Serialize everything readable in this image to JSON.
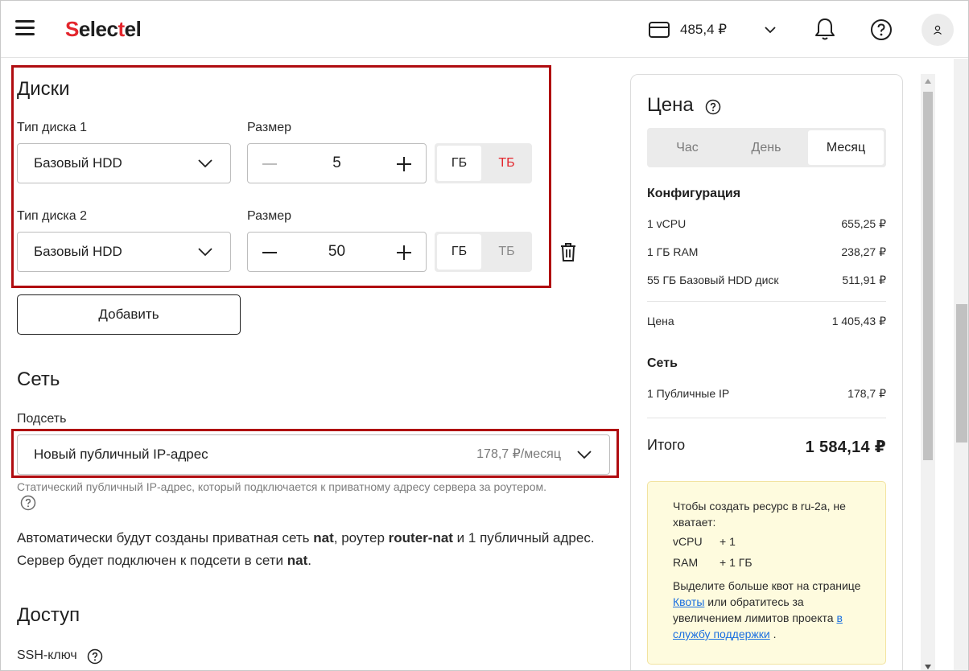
{
  "header": {
    "logo_prefix": "S",
    "logo_mid": "elec",
    "logo_red2": "t",
    "logo_suffix": "el",
    "balance": "485,4 ₽"
  },
  "disks": {
    "title": "Диски",
    "items": [
      {
        "type_label": "Тип диска 1",
        "size_label": "Размер",
        "type_value": "Базовый HDD",
        "size": "5",
        "unit_gb": "ГБ",
        "unit_tb": "ТБ"
      },
      {
        "type_label": "Тип диска 2",
        "size_label": "Размер",
        "type_value": "Базовый HDD",
        "size": "50",
        "unit_gb": "ГБ",
        "unit_tb": "ТБ"
      }
    ],
    "add_label": "Добавить"
  },
  "network": {
    "title": "Сеть",
    "subnet_label": "Подсеть",
    "subnet_value": "Новый публичный IP-адрес",
    "subnet_price": "178,7 ₽/месяц",
    "hint": "Статический публичный IP-адрес, который подключается к приватному адресу сервера за роутером.",
    "para_1": "Автоматически будут созданы приватная сеть ",
    "para_nat": "nat",
    "para_2": ", роутер ",
    "para_router": "router-nat",
    "para_3": " и 1 публичный адрес. Сервер будет подключен к подсети в сети ",
    "para_nat2": "nat",
    "para_4": "."
  },
  "access": {
    "title": "Доступ",
    "ssh_label": "SSH-ключ"
  },
  "price_panel": {
    "title": "Цена",
    "tabs": [
      "Час",
      "День",
      "Месяц"
    ],
    "active_tab": "Месяц",
    "config_title": "Конфигурация",
    "config_rows": [
      {
        "name": "1 vCPU",
        "price": "655,25 ₽"
      },
      {
        "name": "1 ГБ RAM",
        "price": "238,27 ₽"
      },
      {
        "name": "55 ГБ Базовый HDD диск",
        "price": "511,91 ₽"
      }
    ],
    "price_label": "Цена",
    "price_value": "1 405,43 ₽",
    "net_title": "Сеть",
    "net_row": {
      "name": "1 Публичные IP",
      "price": "178,7 ₽"
    },
    "total_label": "Итого",
    "total_value": "1 584,14 ₽"
  },
  "warning": {
    "line1": "Чтобы создать ресурс в ru-2a, не хватает:",
    "vcpu_label": "vCPU",
    "vcpu_value": "+ 1",
    "ram_label": "RAM",
    "ram_value": "+ 1 ГБ",
    "text_1": "Выделите больше квот на странице ",
    "link_quotas": "Квоты",
    "text_2": " или обратитесь за увеличением лимитов проекта ",
    "link_support": "в службу поддержки",
    "text_3": " ."
  },
  "colors": {
    "accent_red": "#e3262d",
    "highlight_border": "#b00c10",
    "link": "#1a6fe0",
    "warning_bg": "#fefbde"
  }
}
